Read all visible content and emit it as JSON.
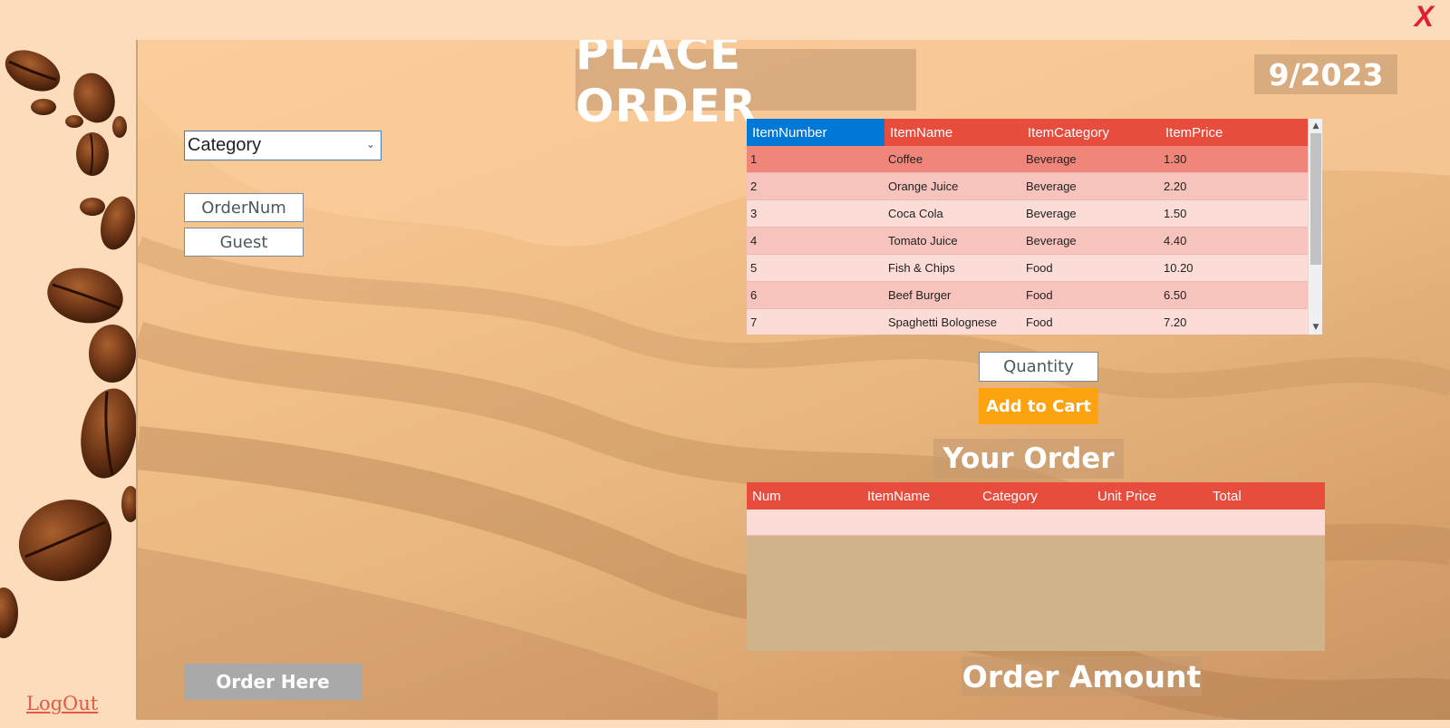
{
  "window": {
    "close_label": "X"
  },
  "sidebar": {
    "logout_label": "LogOut"
  },
  "header": {
    "title": "PLACE ORDER",
    "date": "9/2023"
  },
  "form": {
    "category_value": "Category",
    "ordernum_value": "OrderNum",
    "guest_value": "Guest",
    "order_here_label": "Order Here"
  },
  "items_grid": {
    "columns": [
      "ItemNumber",
      "ItemName",
      "ItemCategory",
      "ItemPrice"
    ],
    "rows": [
      [
        "1",
        "Coffee",
        "Beverage",
        "1.30"
      ],
      [
        "2",
        "Orange Juice",
        "Beverage",
        "2.20"
      ],
      [
        "3",
        "Coca Cola",
        "Beverage",
        "1.50"
      ],
      [
        "4",
        "Tomato Juice",
        "Beverage",
        "4.40"
      ],
      [
        "5",
        "Fish & Chips",
        "Food",
        "10.20"
      ],
      [
        "6",
        "Beef Burger",
        "Food",
        "6.50"
      ],
      [
        "7",
        "Spaghetti Bolognese",
        "Food",
        "7.20"
      ]
    ]
  },
  "cart": {
    "quantity_value": "Quantity",
    "add_label": "Add to Cart",
    "your_order_title": "Your Order",
    "columns": [
      "Num",
      "ItemName",
      "Category",
      "Unit Price",
      "Total"
    ],
    "amount_label": "Order Amount"
  },
  "colors": {
    "accent_red": "#e84c3d",
    "accent_orange": "#fca30f",
    "selected_blue": "#0078d7",
    "close_red": "#e01f30"
  }
}
